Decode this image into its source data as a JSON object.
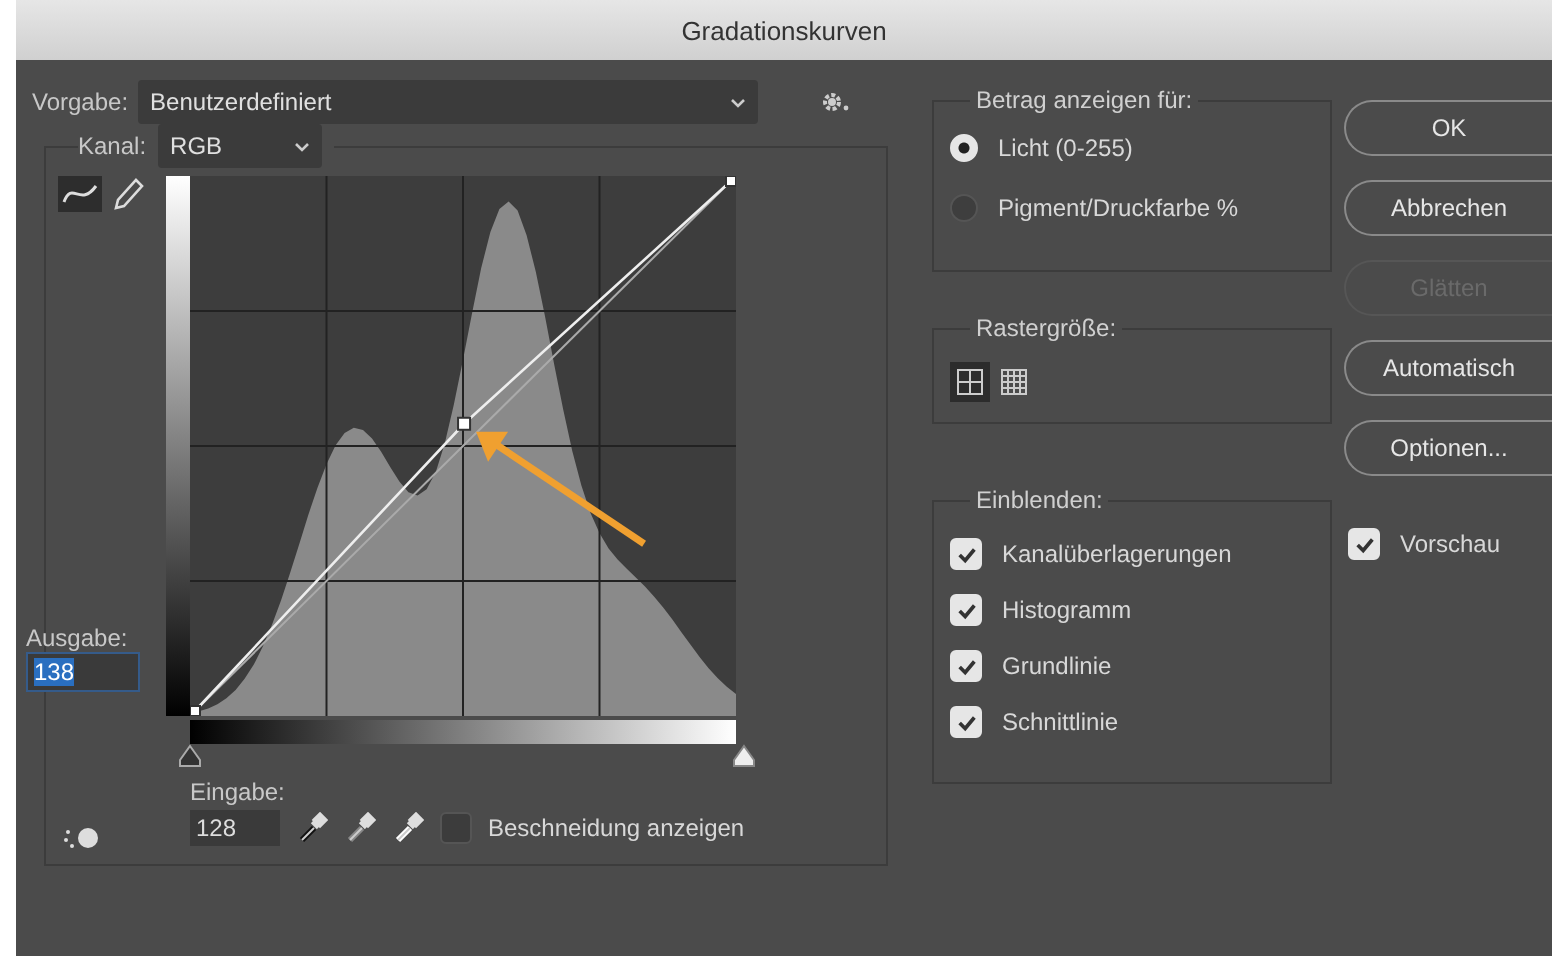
{
  "window": {
    "title": "Gradationskurven"
  },
  "preset": {
    "label": "Vorgabe:",
    "value": "Benutzerdefiniert"
  },
  "channel": {
    "label": "Kanal:",
    "value": "RGB"
  },
  "tools": [
    {
      "kind": "curve",
      "selected": true
    },
    {
      "kind": "pencil",
      "selected": false
    }
  ],
  "output": {
    "label": "Ausgabe:",
    "value": "138"
  },
  "input": {
    "label": "Eingabe:",
    "value": "128"
  },
  "show_clipping": {
    "label": "Beschneidung anzeigen",
    "checked": false
  },
  "display_amount": {
    "title": "Betrag anzeigen für:",
    "options": [
      {
        "label": "Licht (0-255)",
        "selected": true
      },
      {
        "label": "Pigment/Druckfarbe %",
        "selected": false
      }
    ]
  },
  "grid_size": {
    "title": "Rastergröße:",
    "options": [
      {
        "kind": "coarse",
        "selected": true
      },
      {
        "kind": "fine",
        "selected": false
      }
    ]
  },
  "show": {
    "title": "Einblenden:",
    "items": [
      {
        "label": "Kanalüberlagerungen",
        "checked": true
      },
      {
        "label": "Histogramm",
        "checked": true
      },
      {
        "label": "Grundlinie",
        "checked": true
      },
      {
        "label": "Schnittlinie",
        "checked": true
      }
    ]
  },
  "buttons": [
    {
      "label": "OK",
      "disabled": false
    },
    {
      "label": "Abbrechen",
      "disabled": false
    },
    {
      "label": "Glätten",
      "disabled": true
    },
    {
      "label": "Automatisch",
      "disabled": false
    },
    {
      "label": "Optionen...",
      "disabled": false
    }
  ],
  "preview": {
    "label": "Vorschau",
    "checked": true
  }
}
